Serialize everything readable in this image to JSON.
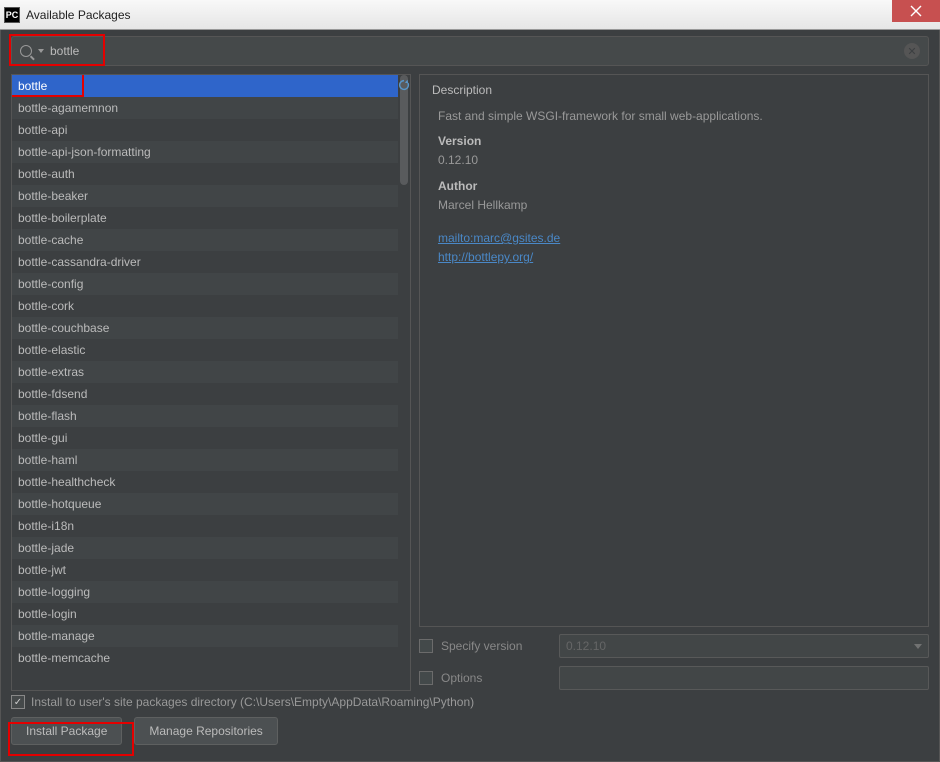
{
  "window": {
    "title": "Available Packages"
  },
  "search": {
    "value": "bottle"
  },
  "packages": [
    "bottle",
    "bottle-agamemnon",
    "bottle-api",
    "bottle-api-json-formatting",
    "bottle-auth",
    "bottle-beaker",
    "bottle-boilerplate",
    "bottle-cache",
    "bottle-cassandra-driver",
    "bottle-config",
    "bottle-cork",
    "bottle-couchbase",
    "bottle-elastic",
    "bottle-extras",
    "bottle-fdsend",
    "bottle-flash",
    "bottle-gui",
    "bottle-haml",
    "bottle-healthcheck",
    "bottle-hotqueue",
    "bottle-i18n",
    "bottle-jade",
    "bottle-jwt",
    "bottle-logging",
    "bottle-login",
    "bottle-manage",
    "bottle-memcache"
  ],
  "selected_index": 0,
  "description": {
    "heading": "Description",
    "summary": "Fast and simple WSGI-framework for small web-applications.",
    "version_label": "Version",
    "version": "0.12.10",
    "author_label": "Author",
    "author": "Marcel Hellkamp",
    "link1": "mailto:marc@gsites.de",
    "link2": "http://bottlepy.org/"
  },
  "options": {
    "specify_version_label": "Specify version",
    "specify_version_value": "0.12.10",
    "options_label": "Options",
    "options_value": ""
  },
  "install_to_user": {
    "checked": true,
    "label": "Install to user's site packages directory (C:\\Users\\Empty\\AppData\\Roaming\\Python)"
  },
  "buttons": {
    "install": "Install Package",
    "manage": "Manage Repositories"
  }
}
